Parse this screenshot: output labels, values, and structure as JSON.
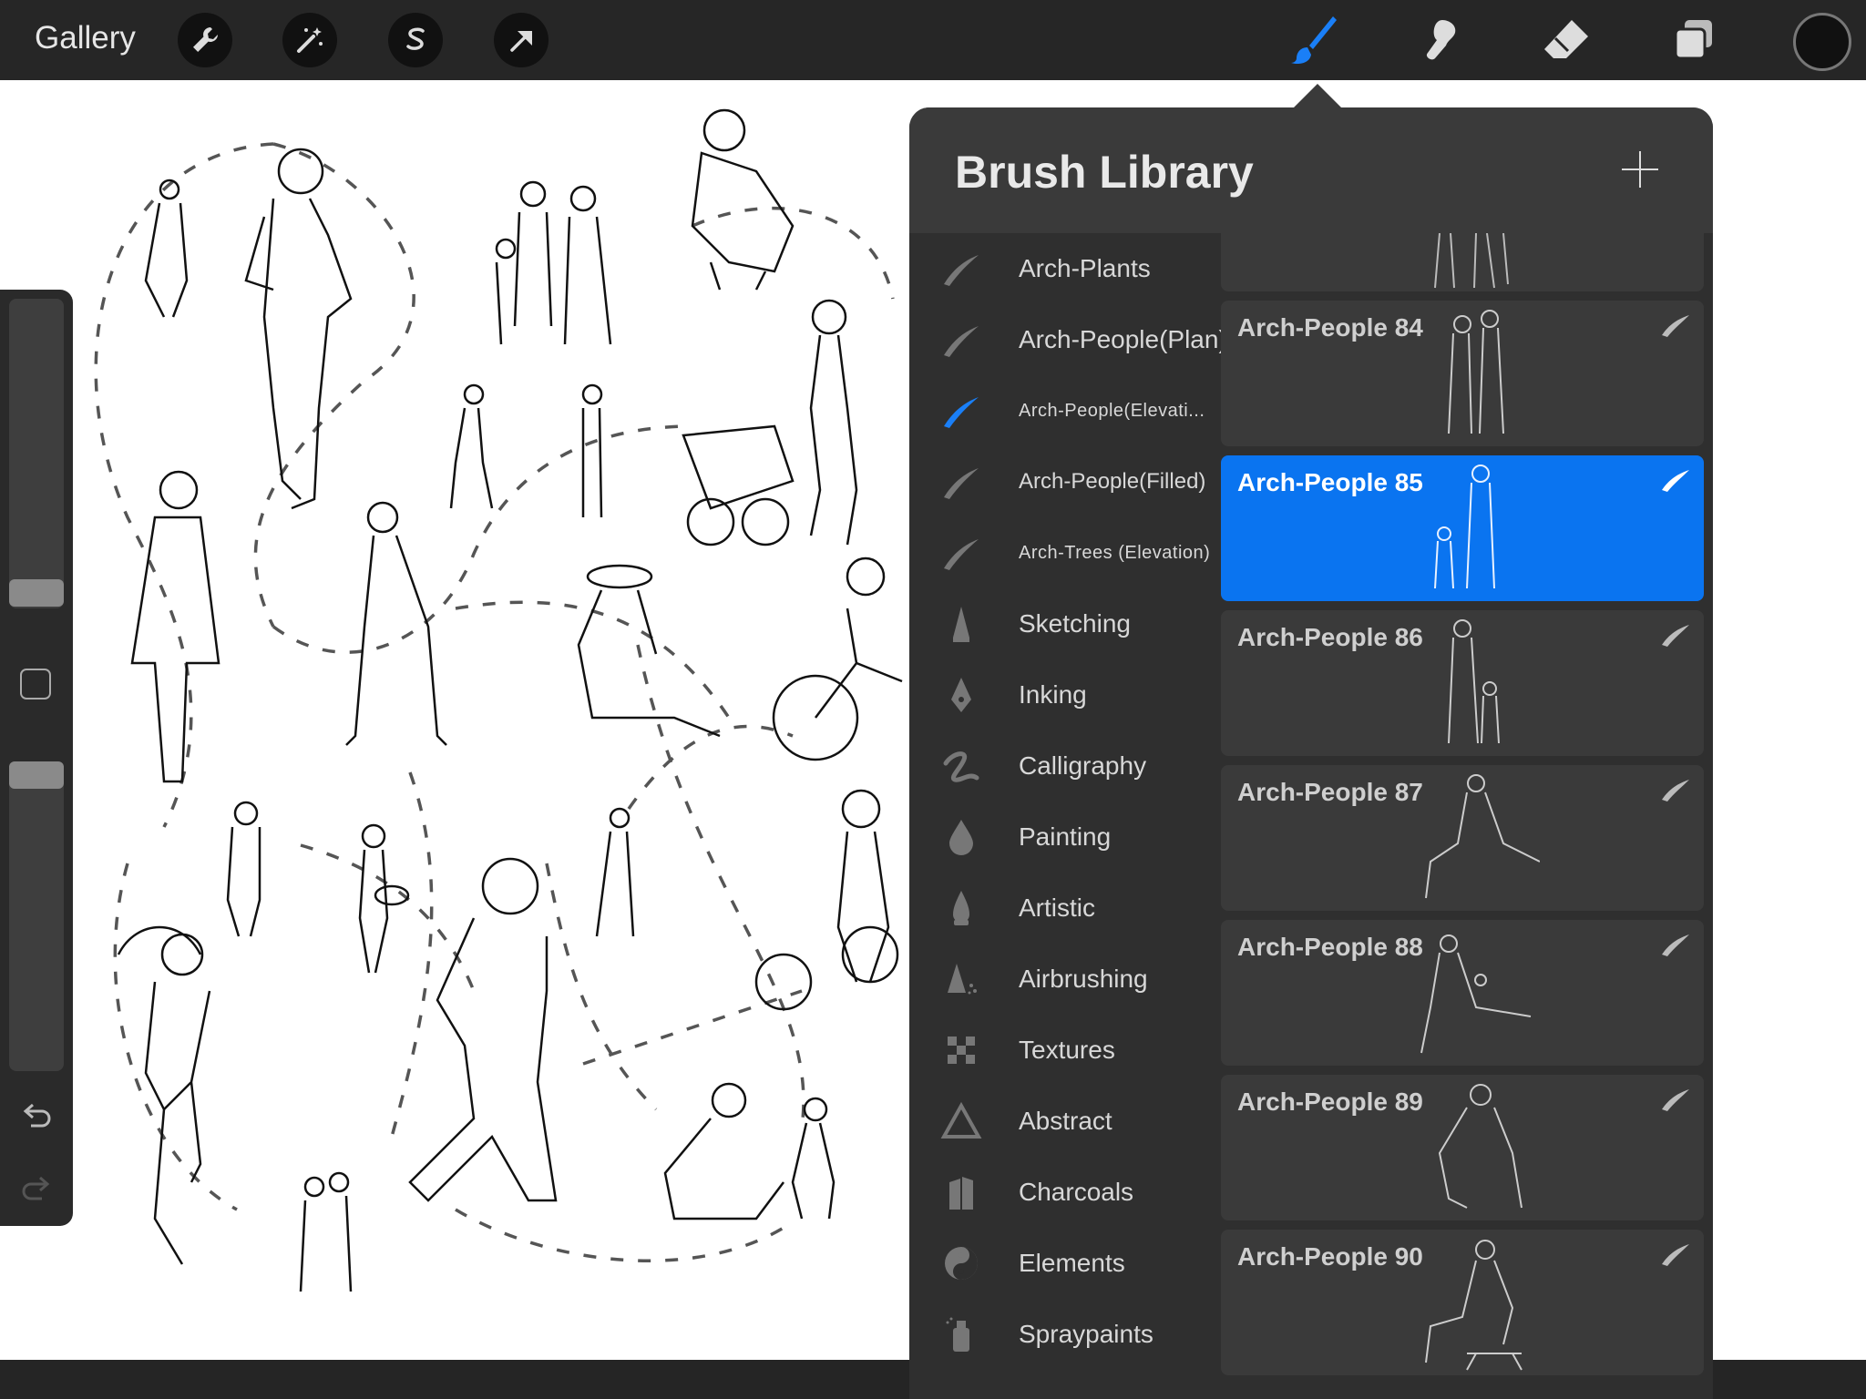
{
  "toolbar": {
    "gallery_label": "Gallery",
    "left_tools": [
      "wrench-icon",
      "magic-wand-icon",
      "selection-icon",
      "transform-arrow-icon"
    ],
    "right_tools": [
      "brush-icon",
      "smudge-icon",
      "eraser-icon",
      "layers-icon"
    ],
    "active_tool": "brush-icon",
    "accent_color": "#0a74f0",
    "current_color": "#111111"
  },
  "brush_library": {
    "title": "Brush Library",
    "sets": [
      {
        "label": "Arch-Plants",
        "icon": "stroke-icon"
      },
      {
        "label": "Arch-People(Plan)",
        "icon": "stroke-icon"
      },
      {
        "label": "Arch-People(Elevati...",
        "icon": "stroke-icon",
        "active": true
      },
      {
        "label": "Arch-People(Filled)",
        "icon": "stroke-icon"
      },
      {
        "label": "Arch-Trees (Elevation)",
        "icon": "stroke-icon"
      },
      {
        "label": "Sketching",
        "icon": "pencil-tip-icon"
      },
      {
        "label": "Inking",
        "icon": "pen-nib-icon"
      },
      {
        "label": "Calligraphy",
        "icon": "calligraphy-icon"
      },
      {
        "label": "Painting",
        "icon": "drop-icon"
      },
      {
        "label": "Artistic",
        "icon": "flame-icon"
      },
      {
        "label": "Airbrushing",
        "icon": "airbrush-icon"
      },
      {
        "label": "Textures",
        "icon": "checker-icon"
      },
      {
        "label": "Abstract",
        "icon": "triangle-icon"
      },
      {
        "label": "Charcoals",
        "icon": "charcoal-icon"
      },
      {
        "label": "Elements",
        "icon": "yin-yang-icon"
      },
      {
        "label": "Spraypaints",
        "icon": "spray-can-icon"
      }
    ],
    "brushes": [
      {
        "label": "Arch-People 84"
      },
      {
        "label": "Arch-People 85",
        "selected": true
      },
      {
        "label": "Arch-People 86"
      },
      {
        "label": "Arch-People 87"
      },
      {
        "label": "Arch-People 88"
      },
      {
        "label": "Arch-People 89"
      },
      {
        "label": "Arch-People 90"
      }
    ]
  }
}
